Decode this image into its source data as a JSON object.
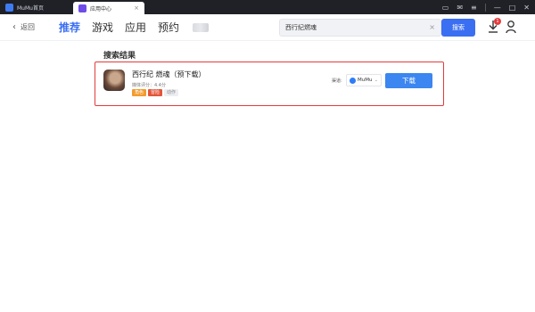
{
  "titlebar": {
    "tabs": [
      {
        "label": "MuMu首页",
        "active": false
      },
      {
        "label": "应用中心",
        "active": true
      }
    ]
  },
  "nav": {
    "back_label": "返回",
    "tabs": [
      {
        "label": "推荐",
        "active": true
      },
      {
        "label": "游戏",
        "active": false
      },
      {
        "label": "应用",
        "active": false
      },
      {
        "label": "预约",
        "active": false
      }
    ],
    "search": {
      "value": "西行纪燃魂"
    },
    "search_button": "搜索",
    "download_badge": "1"
  },
  "results": {
    "title": "搜索结果",
    "items": [
      {
        "name": "西行纪 燃魂（预下载）",
        "rating": "媒体评分：4.4分",
        "tags": [
          "角色",
          "冒险",
          "动作"
        ],
        "channel_label": "渠道:",
        "channel_value": "MuMu",
        "download_label": "下载"
      }
    ]
  },
  "colors": {
    "accent": "#3b6ff2",
    "highlight_border": "#e23b3b",
    "titlebar_bg": "#1f2127"
  }
}
